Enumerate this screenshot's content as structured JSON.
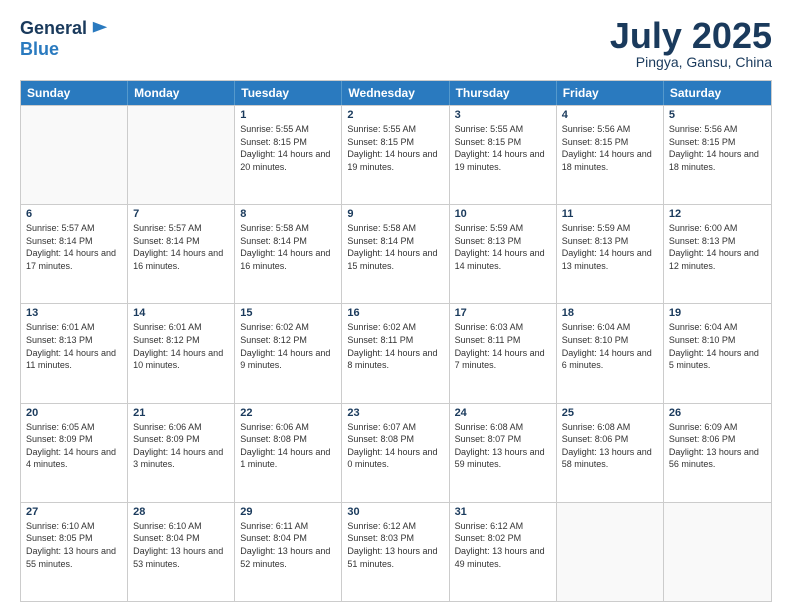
{
  "logo": {
    "general": "General",
    "blue": "Blue"
  },
  "header": {
    "month": "July 2025",
    "location": "Pingya, Gansu, China"
  },
  "days": [
    "Sunday",
    "Monday",
    "Tuesday",
    "Wednesday",
    "Thursday",
    "Friday",
    "Saturday"
  ],
  "weeks": [
    [
      {
        "day": "",
        "empty": true
      },
      {
        "day": "",
        "empty": true
      },
      {
        "day": "1",
        "sunrise": "Sunrise: 5:55 AM",
        "sunset": "Sunset: 8:15 PM",
        "daylight": "Daylight: 14 hours and 20 minutes."
      },
      {
        "day": "2",
        "sunrise": "Sunrise: 5:55 AM",
        "sunset": "Sunset: 8:15 PM",
        "daylight": "Daylight: 14 hours and 19 minutes."
      },
      {
        "day": "3",
        "sunrise": "Sunrise: 5:55 AM",
        "sunset": "Sunset: 8:15 PM",
        "daylight": "Daylight: 14 hours and 19 minutes."
      },
      {
        "day": "4",
        "sunrise": "Sunrise: 5:56 AM",
        "sunset": "Sunset: 8:15 PM",
        "daylight": "Daylight: 14 hours and 18 minutes."
      },
      {
        "day": "5",
        "sunrise": "Sunrise: 5:56 AM",
        "sunset": "Sunset: 8:15 PM",
        "daylight": "Daylight: 14 hours and 18 minutes."
      }
    ],
    [
      {
        "day": "6",
        "sunrise": "Sunrise: 5:57 AM",
        "sunset": "Sunset: 8:14 PM",
        "daylight": "Daylight: 14 hours and 17 minutes."
      },
      {
        "day": "7",
        "sunrise": "Sunrise: 5:57 AM",
        "sunset": "Sunset: 8:14 PM",
        "daylight": "Daylight: 14 hours and 16 minutes."
      },
      {
        "day": "8",
        "sunrise": "Sunrise: 5:58 AM",
        "sunset": "Sunset: 8:14 PM",
        "daylight": "Daylight: 14 hours and 16 minutes."
      },
      {
        "day": "9",
        "sunrise": "Sunrise: 5:58 AM",
        "sunset": "Sunset: 8:14 PM",
        "daylight": "Daylight: 14 hours and 15 minutes."
      },
      {
        "day": "10",
        "sunrise": "Sunrise: 5:59 AM",
        "sunset": "Sunset: 8:13 PM",
        "daylight": "Daylight: 14 hours and 14 minutes."
      },
      {
        "day": "11",
        "sunrise": "Sunrise: 5:59 AM",
        "sunset": "Sunset: 8:13 PM",
        "daylight": "Daylight: 14 hours and 13 minutes."
      },
      {
        "day": "12",
        "sunrise": "Sunrise: 6:00 AM",
        "sunset": "Sunset: 8:13 PM",
        "daylight": "Daylight: 14 hours and 12 minutes."
      }
    ],
    [
      {
        "day": "13",
        "sunrise": "Sunrise: 6:01 AM",
        "sunset": "Sunset: 8:13 PM",
        "daylight": "Daylight: 14 hours and 11 minutes."
      },
      {
        "day": "14",
        "sunrise": "Sunrise: 6:01 AM",
        "sunset": "Sunset: 8:12 PM",
        "daylight": "Daylight: 14 hours and 10 minutes."
      },
      {
        "day": "15",
        "sunrise": "Sunrise: 6:02 AM",
        "sunset": "Sunset: 8:12 PM",
        "daylight": "Daylight: 14 hours and 9 minutes."
      },
      {
        "day": "16",
        "sunrise": "Sunrise: 6:02 AM",
        "sunset": "Sunset: 8:11 PM",
        "daylight": "Daylight: 14 hours and 8 minutes."
      },
      {
        "day": "17",
        "sunrise": "Sunrise: 6:03 AM",
        "sunset": "Sunset: 8:11 PM",
        "daylight": "Daylight: 14 hours and 7 minutes."
      },
      {
        "day": "18",
        "sunrise": "Sunrise: 6:04 AM",
        "sunset": "Sunset: 8:10 PM",
        "daylight": "Daylight: 14 hours and 6 minutes."
      },
      {
        "day": "19",
        "sunrise": "Sunrise: 6:04 AM",
        "sunset": "Sunset: 8:10 PM",
        "daylight": "Daylight: 14 hours and 5 minutes."
      }
    ],
    [
      {
        "day": "20",
        "sunrise": "Sunrise: 6:05 AM",
        "sunset": "Sunset: 8:09 PM",
        "daylight": "Daylight: 14 hours and 4 minutes."
      },
      {
        "day": "21",
        "sunrise": "Sunrise: 6:06 AM",
        "sunset": "Sunset: 8:09 PM",
        "daylight": "Daylight: 14 hours and 3 minutes."
      },
      {
        "day": "22",
        "sunrise": "Sunrise: 6:06 AM",
        "sunset": "Sunset: 8:08 PM",
        "daylight": "Daylight: 14 hours and 1 minute."
      },
      {
        "day": "23",
        "sunrise": "Sunrise: 6:07 AM",
        "sunset": "Sunset: 8:08 PM",
        "daylight": "Daylight: 14 hours and 0 minutes."
      },
      {
        "day": "24",
        "sunrise": "Sunrise: 6:08 AM",
        "sunset": "Sunset: 8:07 PM",
        "daylight": "Daylight: 13 hours and 59 minutes."
      },
      {
        "day": "25",
        "sunrise": "Sunrise: 6:08 AM",
        "sunset": "Sunset: 8:06 PM",
        "daylight": "Daylight: 13 hours and 58 minutes."
      },
      {
        "day": "26",
        "sunrise": "Sunrise: 6:09 AM",
        "sunset": "Sunset: 8:06 PM",
        "daylight": "Daylight: 13 hours and 56 minutes."
      }
    ],
    [
      {
        "day": "27",
        "sunrise": "Sunrise: 6:10 AM",
        "sunset": "Sunset: 8:05 PM",
        "daylight": "Daylight: 13 hours and 55 minutes."
      },
      {
        "day": "28",
        "sunrise": "Sunrise: 6:10 AM",
        "sunset": "Sunset: 8:04 PM",
        "daylight": "Daylight: 13 hours and 53 minutes."
      },
      {
        "day": "29",
        "sunrise": "Sunrise: 6:11 AM",
        "sunset": "Sunset: 8:04 PM",
        "daylight": "Daylight: 13 hours and 52 minutes."
      },
      {
        "day": "30",
        "sunrise": "Sunrise: 6:12 AM",
        "sunset": "Sunset: 8:03 PM",
        "daylight": "Daylight: 13 hours and 51 minutes."
      },
      {
        "day": "31",
        "sunrise": "Sunrise: 6:12 AM",
        "sunset": "Sunset: 8:02 PM",
        "daylight": "Daylight: 13 hours and 49 minutes."
      },
      {
        "day": "",
        "empty": true
      },
      {
        "day": "",
        "empty": true
      }
    ]
  ]
}
